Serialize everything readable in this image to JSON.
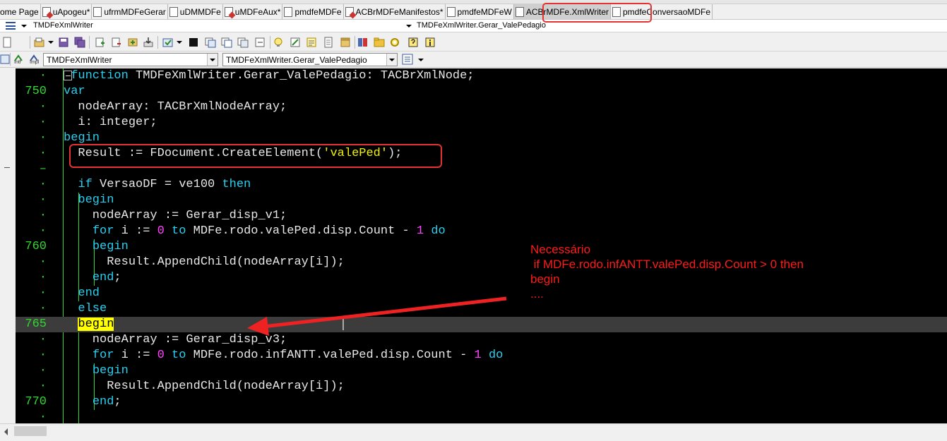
{
  "tabs": [
    {
      "label": "ome Page",
      "icon": "page-icon",
      "active": false
    },
    {
      "label": "uApogeu*",
      "icon": "page-icon",
      "active": false
    },
    {
      "label": "ufrmMDFeGerar",
      "icon": "page-icon",
      "active": false
    },
    {
      "label": "uDMMDFe",
      "icon": "page-icon",
      "active": false
    },
    {
      "label": "uMDFeAux*",
      "icon": "page-icon",
      "active": false
    },
    {
      "label": "pmdfeMDFe",
      "icon": "page-icon",
      "active": false
    },
    {
      "label": "ACBrMDFeManifestos*",
      "icon": "page-icon",
      "active": false
    },
    {
      "label": "pmdfeMDFeW",
      "icon": "page-icon",
      "active": false
    },
    {
      "label": "ACBrMDFe.XmlWriter",
      "icon": "page-icon",
      "active": true
    },
    {
      "label": "pmdfeConversaoMDFe",
      "icon": "page-icon",
      "active": false
    }
  ],
  "header": {
    "unit_name": "TMDFeXmlWriter",
    "method_name": "TMDFeXmlWriter.Gerar_ValePedagio"
  },
  "toolbar2": {
    "class_combo": "TMDFeXmlWriter",
    "method_combo": "TMDFeXmlWriter.Gerar_ValePedagio",
    "intf_label": "Intf",
    "impl_label": "Impl"
  },
  "editor": {
    "lines": [
      {
        "num": "·",
        "text": "function TMDFeXmlWriter.Gerar_ValePedagio: TACBrXmlNode;"
      },
      {
        "num": "750",
        "text": "var"
      },
      {
        "num": "·",
        "text": "  nodeArray: TACBrXmlNodeArray;"
      },
      {
        "num": "·",
        "text": "  i: integer;"
      },
      {
        "num": "·",
        "text": "begin"
      },
      {
        "num": "·",
        "text": "  Result := FDocument.CreateElement('valePed');"
      },
      {
        "num": "–",
        "text": ""
      },
      {
        "num": "·",
        "text": "  if VersaoDF = ve100 then"
      },
      {
        "num": "·",
        "text": "  begin"
      },
      {
        "num": "·",
        "text": "    nodeArray := Gerar_disp_v1;"
      },
      {
        "num": "·",
        "text": "    for i := 0 to MDFe.rodo.valePed.disp.Count - 1 do"
      },
      {
        "num": "760",
        "text": "    begin"
      },
      {
        "num": "·",
        "text": "      Result.AppendChild(nodeArray[i]);"
      },
      {
        "num": "·",
        "text": "    end;"
      },
      {
        "num": "·",
        "text": "  end"
      },
      {
        "num": "·",
        "text": "  else"
      },
      {
        "num": "765",
        "text": "  begin"
      },
      {
        "num": "·",
        "text": "    nodeArray := Gerar_disp_v3;"
      },
      {
        "num": "·",
        "text": "    for i := 0 to MDFe.rodo.infANTT.valePed.disp.Count - 1 do"
      },
      {
        "num": "·",
        "text": "    begin"
      },
      {
        "num": "·",
        "text": "      Result.AppendChild(nodeArray[i]);"
      },
      {
        "num": "770",
        "text": "    end;"
      },
      {
        "num": "·",
        "text": ""
      }
    ]
  },
  "annotation": {
    "text": "Necessário\n if MDFe.rodo.infANTT.valePed.disp.Count > 0 then\nbegin\n....",
    "color": "#ff1a1a"
  },
  "colors": {
    "keyword": "#28d0f0",
    "string": "#f0f000",
    "number": "#ff40ff",
    "line_number": "#2fd82f",
    "editor_bg": "#000000",
    "highlight_word_bg": "#ffff00"
  }
}
